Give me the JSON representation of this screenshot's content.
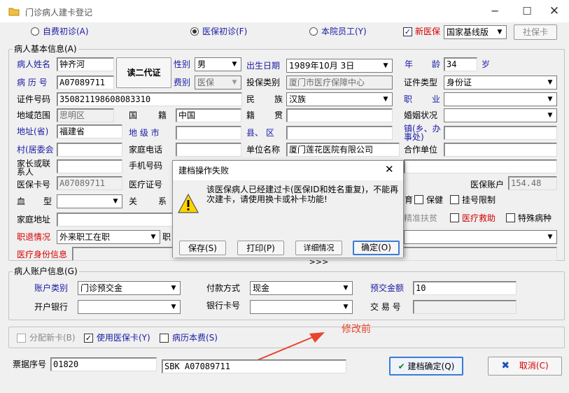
{
  "window": {
    "title": "门诊病人建卡登记",
    "min_icon": "minimize-icon",
    "max_icon": "maximize-icon",
    "close_icon": "close-icon"
  },
  "top": {
    "radio_self": "自费初诊(A)",
    "radio_insure": "医保初诊(F)",
    "radio_staff": "本院员工(Y)",
    "new_insure_label": "新医保",
    "insure_type": "国家基线版",
    "social_card_btn": "社保卡"
  },
  "basic": {
    "group_title": "病人基本信息(A)",
    "name_label": "病人姓名",
    "name": "钟齐河",
    "read_id_btn": "读二代证",
    "gender_label": "性别",
    "gender": "男",
    "birth_label": "出生日期",
    "birth": "1989年10月 3日",
    "age_label_1": "年",
    "age_label_2": "龄",
    "age": "34",
    "age_unit": "岁",
    "record_label": "病 历 号",
    "record": "A07089711",
    "fee_label": "费别",
    "fee": "医保",
    "insure_cat_label": "投保类别",
    "insure_cat": "厦门市医疗保障中心",
    "id_type_label": "证件类型",
    "id_type": "身份证",
    "id_no_label": "证件号码",
    "id_no": "350821198608083310",
    "ethnic_label_1": "民",
    "ethnic_label_2": "族",
    "ethnic": "汉族",
    "job_label_1": "职",
    "job_label_2": "业",
    "job": "",
    "region_label": "地域范围",
    "region": "思明区",
    "nation_label_1": "国",
    "nation_label_2": "籍",
    "nation": "中国",
    "native_label_1": "籍",
    "native_label_2": "贯",
    "marriage_label": "婚姻状况",
    "addr_label": "地址(省)",
    "addr": "福建省",
    "city_label": "地 级 市",
    "county_label": "县、 区",
    "town_label": "镇(乡、办事处)",
    "village_label": "村(居委会",
    "home_phone_label": "家庭电话",
    "work_label": "单位名称",
    "work": "厦门莲花医院有限公司",
    "coop_label": "合作单位",
    "guardian_label": "家长或联系人",
    "mobile_label": "手机号码",
    "ins_card_label": "医保卡号",
    "ins_card": "A07089711",
    "med_card_label": "医疗证号",
    "ins_account_label": "医保账户",
    "ins_account": "154.48",
    "blood_label": "血",
    "blood_label_2": "型",
    "relation_label_1": "关",
    "relation_label_2": "系",
    "opt_birth": "育",
    "opt_health": "保健",
    "opt_reg_limit": "挂号限制",
    "home_addr_label": "家庭地址",
    "opt_poverty": "精准扶贫",
    "opt_aid": "医疗救助",
    "opt_special": "特殊病种",
    "retire_label": "职退情况",
    "retire": "外来职工在职",
    "retire_short": "职",
    "med_identity_label": "医疗身份信息"
  },
  "dialog": {
    "title": "建档操作失败",
    "message": "该医保病人已经建过卡(医保ID和姓名重复)，不能再次建卡，请使用换卡或补卡功能!",
    "save_btn": "保存(S)",
    "print_btn": "打印(P)",
    "details_btn": "详细情况>>>",
    "ok_btn": "确定(O)",
    "warning_icon": "warning-icon"
  },
  "account": {
    "group_title": "病人账户信息(G)",
    "acct_type_label": "账户类别",
    "acct_type": "门诊预交金",
    "pay_label": "付款方式",
    "pay": "现金",
    "prepay_label": "预交金额",
    "prepay": "10",
    "bank_label": "开户银行",
    "bank_card_label": "银行卡号",
    "trade_label": "交 易 号"
  },
  "options": {
    "assign_card": "分配新卡(B)",
    "use_ins_card": "使用医保卡(Y)",
    "record_fee": "病历本费(S)"
  },
  "annotation": {
    "text": "修改前",
    "color": "#e8452c"
  },
  "footer": {
    "ticket_label": "票据序号",
    "ticket": "01820",
    "sbk": "SBK A07089711",
    "confirm_btn": "建档确定(Q)",
    "cancel_btn": "取消(C)"
  }
}
